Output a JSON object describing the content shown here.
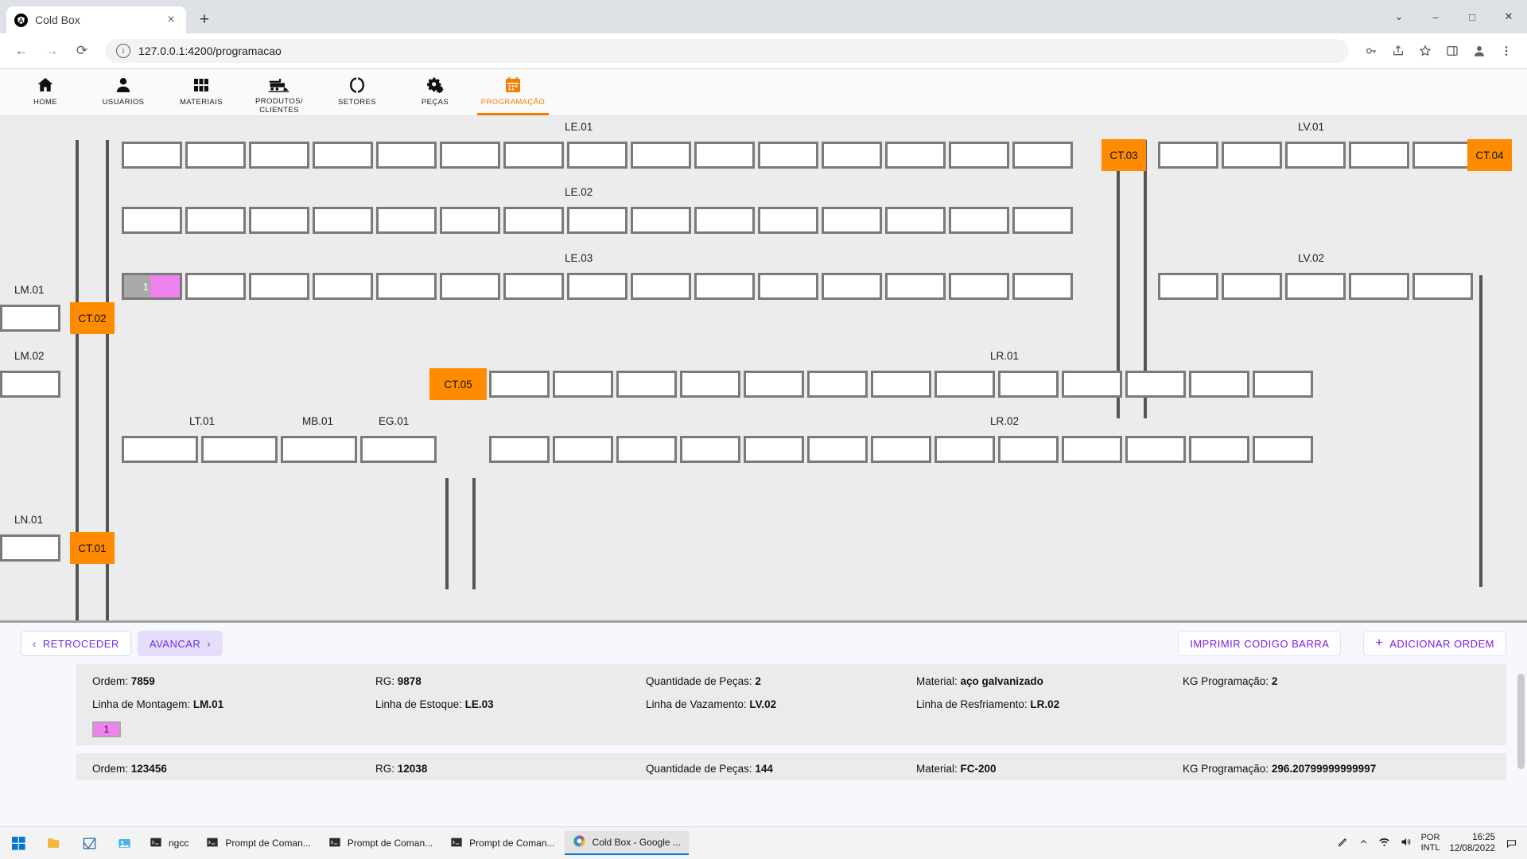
{
  "browser": {
    "tab_title": "Cold Box",
    "tab_close": "×",
    "new_tab": "+",
    "back": "←",
    "forward": "→",
    "reload": "⟳",
    "info_icon": "i",
    "url": "127.0.0.1:4200/programacao",
    "win_minimize": "–",
    "win_maximize": "□",
    "win_close": "✕",
    "win_more": "⌄",
    "icons": {
      "key": "key-icon",
      "share": "share-icon",
      "star": "star-icon",
      "sidepanel": "side-panel-icon",
      "profile": "profile-icon",
      "menu": "kebab-menu-icon"
    }
  },
  "appnav": {
    "items": [
      {
        "label": "HOME",
        "icon": "home-icon",
        "active": false
      },
      {
        "label": "USUARIOS",
        "icon": "person-icon",
        "active": false
      },
      {
        "label": "MATERIAIS",
        "icon": "grid-icon",
        "active": false
      },
      {
        "label": "PRODUTOS/\nCLIENTES",
        "icon": "train-icon",
        "active": false
      },
      {
        "label": "SETORES",
        "icon": "brackets-icon",
        "active": false
      },
      {
        "label": "PEÇAS",
        "icon": "gears-icon",
        "active": false
      },
      {
        "label": "PROGRAMAÇÃO",
        "icon": "calendar-icon",
        "active": true
      }
    ],
    "accent": "#f57c00"
  },
  "board": {
    "line_labels": [
      {
        "name": "LE.01"
      },
      {
        "name": "LV.01"
      },
      {
        "name": "LE.02"
      },
      {
        "name": "LE.03"
      },
      {
        "name": "LV.02"
      },
      {
        "name": "LM.01"
      },
      {
        "name": "LM.02"
      },
      {
        "name": "LR.01"
      },
      {
        "name": "LT.01"
      },
      {
        "name": "MB.01"
      },
      {
        "name": "EG.01"
      },
      {
        "name": "LR.02"
      },
      {
        "name": "LN.01"
      }
    ],
    "ct_stations": [
      "CT.01",
      "CT.02",
      "CT.03",
      "CT.04",
      "CT.05"
    ],
    "ct_color": "#ff8c00",
    "occupied_cell": {
      "number": "1",
      "color": "#ee82ee",
      "left_color": "#a9a9a9"
    },
    "cell_border": "#7a7a7a",
    "background": "#ececec"
  },
  "toolbar": {
    "retroceder": "RETROCEDER",
    "avancar": "AVANCAR",
    "imprimir": "IMPRIMIR CODIGO BARRA",
    "adicionar": "ADICIONAR ORDEM",
    "chev_left": "‹",
    "chev_right": "›",
    "plus": "+",
    "accent": "#6d2fe8"
  },
  "orders": [
    {
      "ordem_label": "Ordem:",
      "ordem": "7859",
      "rg_label": "RG:",
      "rg": "9878",
      "qtd_label": "Quantidade de Peças:",
      "qtd": "2",
      "material_label": "Material:",
      "material": "aço galvanizado",
      "kg_label": "KG Programação:",
      "kg": "2",
      "lm_label": "Linha de Montagem:",
      "lm": "LM.01",
      "le_label": "Linha de Estoque:",
      "le": "LE.03",
      "lv_label": "Linha de Vazamento:",
      "lv": "LV.02",
      "lr_label": "Linha de Resfriamento:",
      "lr": "LR.02",
      "chip": "1"
    },
    {
      "ordem_label": "Ordem:",
      "ordem": "123456",
      "rg_label": "RG:",
      "rg": "12038",
      "qtd_label": "Quantidade de Peças:",
      "qtd": "144",
      "material_label": "Material:",
      "material": "FC-200",
      "kg_label": "KG Programação:",
      "kg": "296.20799999999997"
    }
  ],
  "taskbar": {
    "start": "start-icon",
    "pinned": [
      "folder-icon",
      "app-icon",
      "photos-icon"
    ],
    "windows": [
      {
        "label": "ngcc",
        "icon": "terminal-icon",
        "active": false
      },
      {
        "label": "Prompt de Coman...",
        "icon": "terminal-icon",
        "active": false
      },
      {
        "label": "Prompt de Coman...",
        "icon": "terminal-icon",
        "active": false
      },
      {
        "label": "Prompt de Coman...",
        "icon": "terminal-icon",
        "active": false
      },
      {
        "label": "Cold Box - Google ...",
        "icon": "chrome-icon",
        "active": true
      }
    ],
    "lang_line1": "POR",
    "lang_line2": "INTL",
    "time": "16:25",
    "date": "12/08/2022",
    "tray": [
      "pen-icon",
      "chevron-up-icon",
      "network-icon",
      "volume-icon"
    ],
    "notif": "▭"
  }
}
